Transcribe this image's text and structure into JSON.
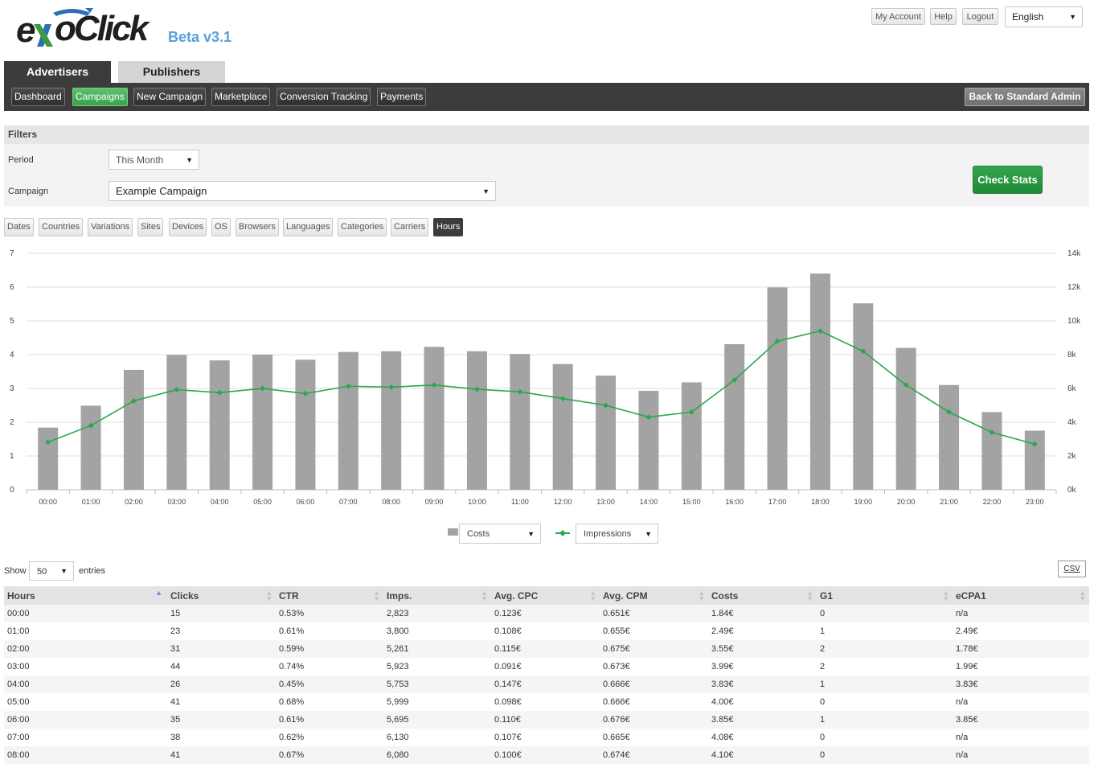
{
  "app": {
    "logo_text": "exoClick",
    "version": "Beta v3.1"
  },
  "topbar": {
    "my_account": "My Account",
    "help": "Help",
    "logout": "Logout",
    "language": "English"
  },
  "main_tabs": [
    {
      "label": "Advertisers",
      "active": true
    },
    {
      "label": "Publishers",
      "active": false
    }
  ],
  "nav": {
    "items": [
      {
        "label": "Dashboard",
        "active": false
      },
      {
        "label": "Campaigns",
        "active": true
      },
      {
        "label": "New Campaign",
        "active": false
      },
      {
        "label": "Marketplace",
        "active": false
      },
      {
        "label": "Conversion Tracking",
        "active": false
      },
      {
        "label": "Payments",
        "active": false
      }
    ],
    "back_label": "Back to Standard Admin"
  },
  "filters": {
    "title": "Filters",
    "period_label": "Period",
    "period_value": "This Month",
    "campaign_label": "Campaign",
    "campaign_value": "Example Campaign",
    "check_stats": "Check Stats"
  },
  "stat_tabs": [
    {
      "label": "Dates",
      "active": false
    },
    {
      "label": "Countries",
      "active": false
    },
    {
      "label": "Variations",
      "active": false
    },
    {
      "label": "Sites",
      "active": false
    },
    {
      "label": "Devices",
      "active": false
    },
    {
      "label": "OS",
      "active": false
    },
    {
      "label": "Browsers",
      "active": false
    },
    {
      "label": "Languages",
      "active": false
    },
    {
      "label": "Categories",
      "active": false
    },
    {
      "label": "Carriers",
      "active": false
    },
    {
      "label": "Hours",
      "active": true
    }
  ],
  "chart_data": {
    "type": "bar",
    "categories": [
      "00:00",
      "01:00",
      "02:00",
      "03:00",
      "04:00",
      "05:00",
      "06:00",
      "07:00",
      "08:00",
      "09:00",
      "10:00",
      "11:00",
      "12:00",
      "13:00",
      "14:00",
      "15:00",
      "16:00",
      "17:00",
      "18:00",
      "19:00",
      "20:00",
      "21:00",
      "22:00",
      "23:00"
    ],
    "series": [
      {
        "name": "Costs",
        "kind": "bar",
        "axis": "left",
        "color": "#a3a3a3",
        "values": [
          1.84,
          2.49,
          3.55,
          3.99,
          3.83,
          4.0,
          3.85,
          4.08,
          4.1,
          4.23,
          4.1,
          4.02,
          3.72,
          3.38,
          2.93,
          3.18,
          4.31,
          5.99,
          6.4,
          5.52,
          4.2,
          3.1,
          2.3,
          1.75
        ]
      },
      {
        "name": "Impressions",
        "kind": "line",
        "axis": "right",
        "color": "#2aa84a",
        "values": [
          2823,
          3800,
          5261,
          5923,
          5753,
          5999,
          5695,
          6130,
          6080,
          6200,
          5950,
          5800,
          5400,
          5000,
          4300,
          4600,
          6500,
          8800,
          9400,
          8200,
          6200,
          4600,
          3400,
          2700
        ]
      }
    ],
    "y_left": {
      "ticks": [
        "0",
        "1",
        "2",
        "3",
        "4",
        "5",
        "6",
        "7"
      ],
      "min": 0,
      "max": 7
    },
    "y_right": {
      "ticks": [
        "0k",
        "2k",
        "4k",
        "6k",
        "8k",
        "10k",
        "12k",
        "14k"
      ],
      "min": 0,
      "max": 14000
    },
    "grid": true
  },
  "legend": {
    "left_select": "Costs",
    "right_select": "Impressions"
  },
  "table": {
    "show_label": "Show",
    "entries_value": "50",
    "entries_label": "entries",
    "csv_label": "CSV",
    "columns": [
      "Hours",
      "Clicks",
      "CTR",
      "Imps.",
      "Avg. CPC",
      "Avg. CPM",
      "Costs",
      "G1",
      "eCPA1"
    ],
    "rows": [
      [
        "00:00",
        "15",
        "0.53%",
        "2,823",
        "0.123€",
        "0.651€",
        "1.84€",
        "0",
        "n/a"
      ],
      [
        "01:00",
        "23",
        "0.61%",
        "3,800",
        "0.108€",
        "0.655€",
        "2.49€",
        "1",
        "2.49€"
      ],
      [
        "02:00",
        "31",
        "0.59%",
        "5,261",
        "0.115€",
        "0.675€",
        "3.55€",
        "2",
        "1.78€"
      ],
      [
        "03:00",
        "44",
        "0.74%",
        "5,923",
        "0.091€",
        "0.673€",
        "3.99€",
        "2",
        "1.99€"
      ],
      [
        "04:00",
        "26",
        "0.45%",
        "5,753",
        "0.147€",
        "0.666€",
        "3.83€",
        "1",
        "3.83€"
      ],
      [
        "05:00",
        "41",
        "0.68%",
        "5,999",
        "0.098€",
        "0.666€",
        "4.00€",
        "0",
        "n/a"
      ],
      [
        "06:00",
        "35",
        "0.61%",
        "5,695",
        "0.110€",
        "0.676€",
        "3.85€",
        "1",
        "3.85€"
      ],
      [
        "07:00",
        "38",
        "0.62%",
        "6,130",
        "0.107€",
        "0.665€",
        "4.08€",
        "0",
        "n/a"
      ],
      [
        "08:00",
        "41",
        "0.67%",
        "6,080",
        "0.100€",
        "0.674€",
        "4.10€",
        "0",
        "n/a"
      ]
    ]
  }
}
